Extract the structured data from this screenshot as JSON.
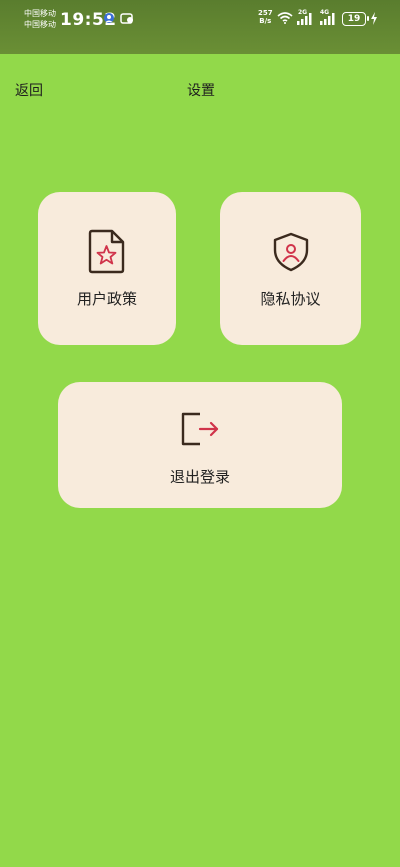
{
  "status_bar": {
    "carrier_1": "中国移动",
    "carrier_2": "中国移动",
    "time": "19:52",
    "net_speed_value": "257",
    "net_speed_unit": "B/s",
    "signal_1_label": "2G",
    "signal_2_label": "4G",
    "battery": "19"
  },
  "nav": {
    "back_label": "返回",
    "title": "设置"
  },
  "cards": {
    "policy": {
      "label": "用户政策",
      "icon": "document-star-icon"
    },
    "privacy": {
      "label": "隐私协议",
      "icon": "shield-user-icon"
    },
    "logout": {
      "label": "退出登录",
      "icon": "logout-arrow-icon"
    }
  },
  "colors": {
    "background": "#92d94a",
    "status_bar": "#5f8530",
    "card": "#f8ebdc",
    "icon_outline": "#3b2a1e",
    "icon_accent": "#d0334a"
  }
}
